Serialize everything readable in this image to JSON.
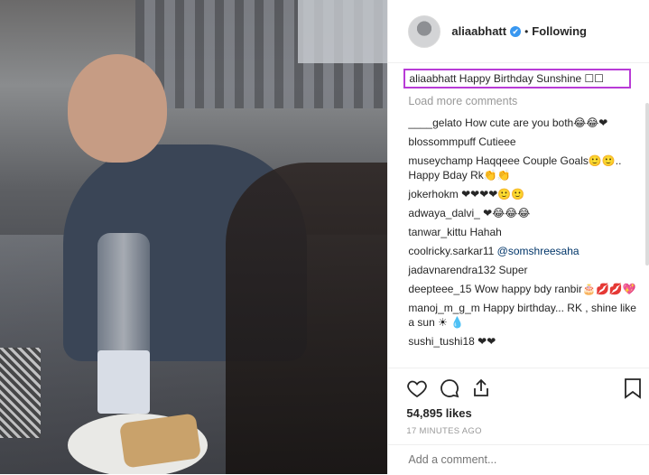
{
  "header": {
    "username": "aliaabhatt",
    "verified_symbol": "✔",
    "separator": "•",
    "follow_label": "Following"
  },
  "caption": {
    "username": "aliaabhatt",
    "text": "Happy Birthday Sunshine ☐☐"
  },
  "load_more_label": "Load more comments",
  "comments": [
    {
      "user": "____gelato",
      "text": "How cute are you both😂😂❤"
    },
    {
      "user": "blossommpuff",
      "text": "Cutieee"
    },
    {
      "user": "museychamp",
      "text": "Haqqeee Couple Goals🙂🙂.. Happy Bday Rk👏👏"
    },
    {
      "user": "jokerhokm",
      "text": "❤❤❤❤🙂🙂"
    },
    {
      "user": "adwaya_dalvi_",
      "text": "❤😂😂😂"
    },
    {
      "user": "tanwar_kittu",
      "text": "Hahah"
    },
    {
      "user": "coolricky.sarkar11",
      "mention": "@somshreesaha"
    },
    {
      "user": "jadavnarendra132",
      "text": "Super"
    },
    {
      "user": "deepteee_15",
      "text": "Wow happy bdy ranbir🎂💋💋💖"
    },
    {
      "user": "manoj_m_g_m",
      "text": "Happy birthday... RK , shine like a sun ☀ 💧"
    },
    {
      "user": "sushi_tushi18",
      "text": "❤❤"
    }
  ],
  "likes": "54,895 likes",
  "time": "17 MINUTES AGO",
  "add_comment_placeholder": "Add a comment..."
}
